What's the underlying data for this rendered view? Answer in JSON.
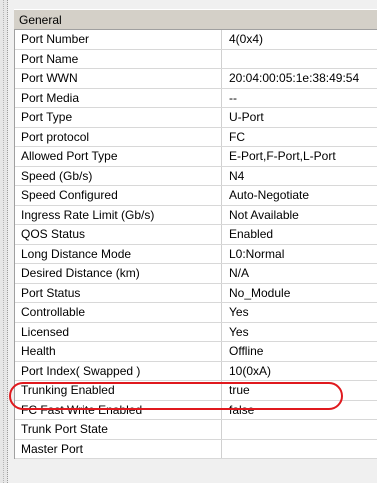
{
  "section": {
    "title": "General"
  },
  "properties": [
    {
      "name": "Port Number",
      "value": "4(0x4)"
    },
    {
      "name": "Port Name",
      "value": ""
    },
    {
      "name": "Port WWN",
      "value": "20:04:00:05:1e:38:49:54"
    },
    {
      "name": "Port Media",
      "value": "--"
    },
    {
      "name": "Port Type",
      "value": "U-Port"
    },
    {
      "name": "Port protocol",
      "value": "FC"
    },
    {
      "name": "Allowed Port Type",
      "value": "E-Port,F-Port,L-Port"
    },
    {
      "name": "Speed (Gb/s)",
      "value": "N4"
    },
    {
      "name": "Speed Configured",
      "value": "Auto-Negotiate"
    },
    {
      "name": "Ingress Rate Limit (Gb/s)",
      "value": "Not Available"
    },
    {
      "name": "QOS Status",
      "value": "Enabled"
    },
    {
      "name": "Long Distance Mode",
      "value": "L0:Normal"
    },
    {
      "name": "Desired Distance (km)",
      "value": "N/A"
    },
    {
      "name": "Port Status",
      "value": "No_Module"
    },
    {
      "name": "Controllable",
      "value": "Yes"
    },
    {
      "name": "Licensed",
      "value": "Yes"
    },
    {
      "name": "Health",
      "value": "Offline"
    },
    {
      "name": "Port Index( Swapped )",
      "value": "10(0xA)"
    },
    {
      "name": "Trunking Enabled",
      "value": "true"
    },
    {
      "name": "FC Fast Write Enabled",
      "value": "false"
    },
    {
      "name": "Trunk Port State",
      "value": ""
    },
    {
      "name": "Master Port",
      "value": ""
    }
  ],
  "highlight": {
    "color": "#e0191e",
    "target": "Port Index( Swapped )"
  }
}
